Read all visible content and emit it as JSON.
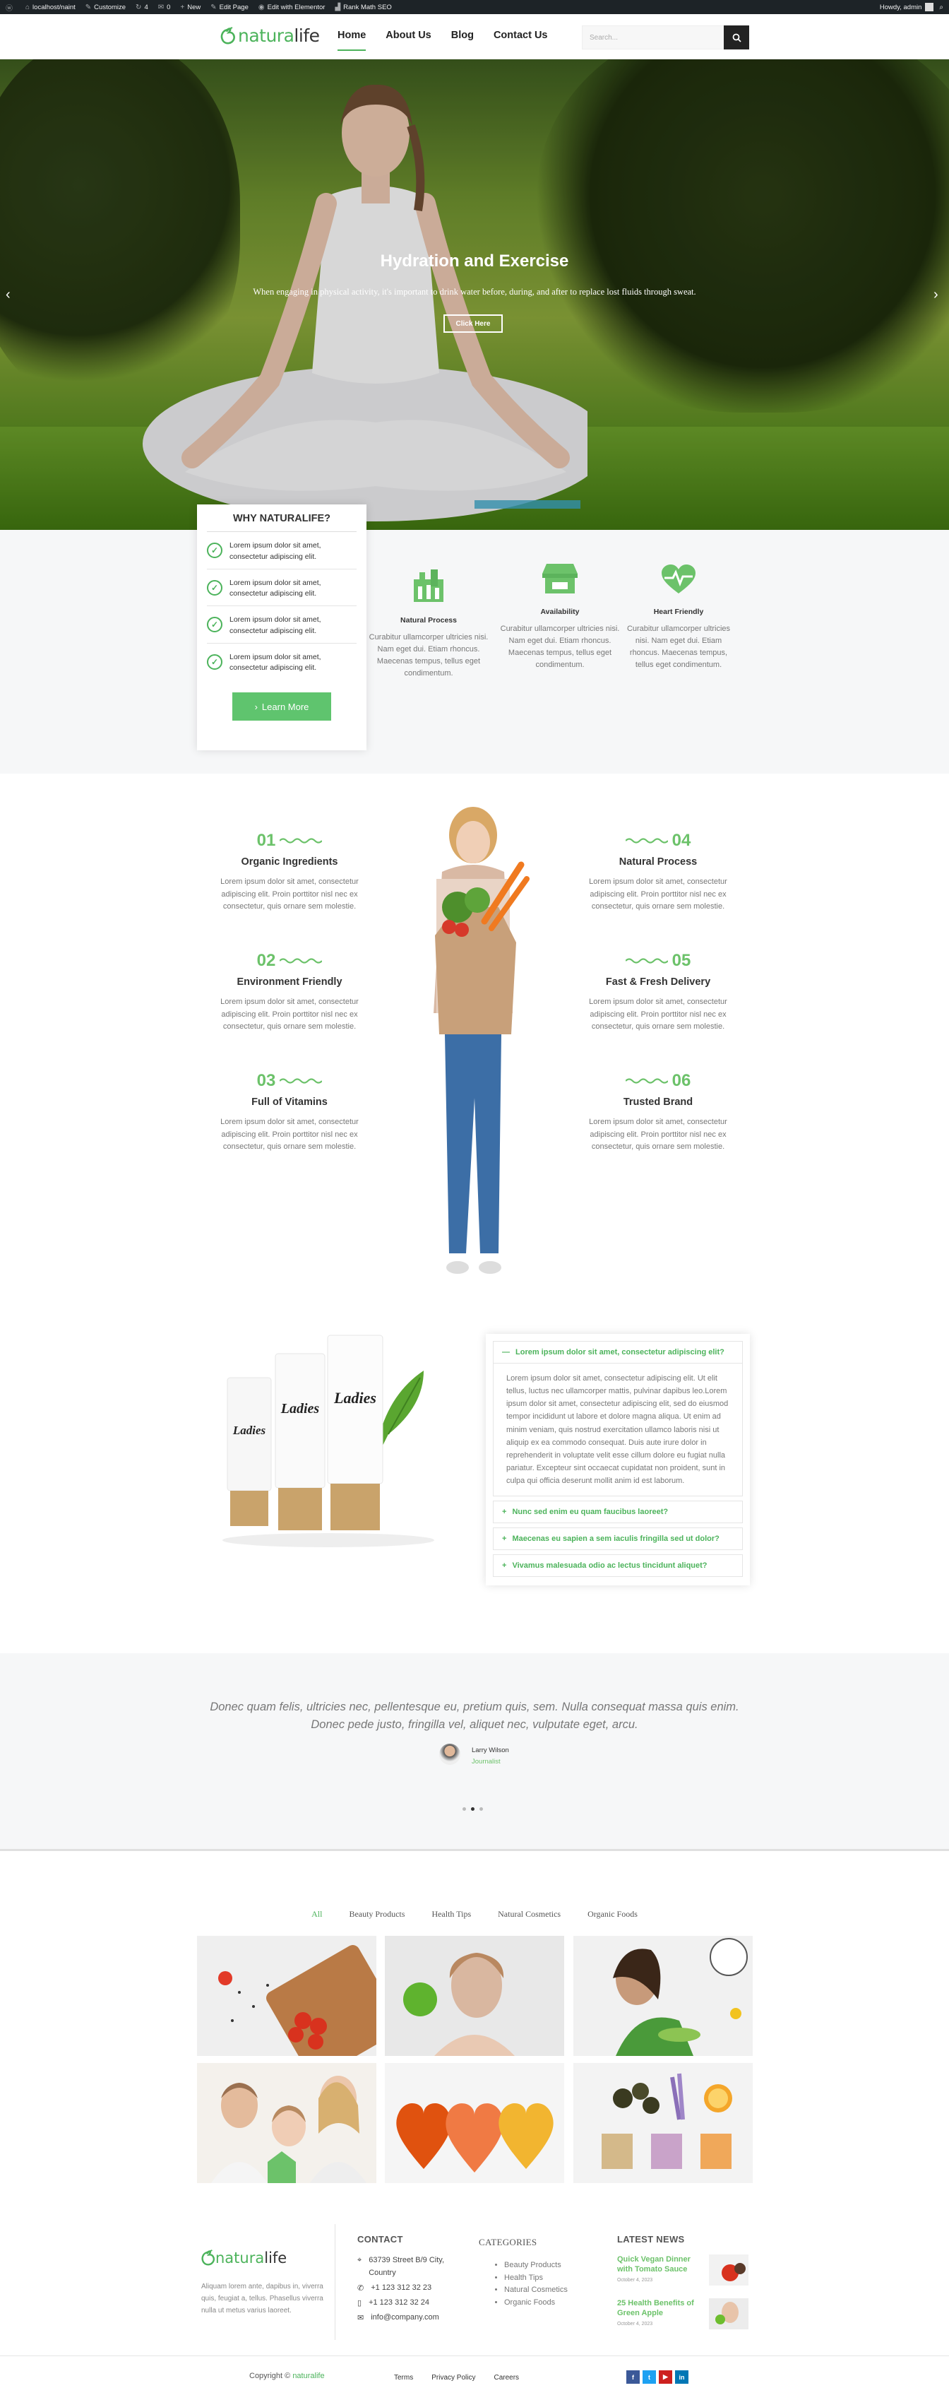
{
  "adminbar": {
    "site": "localhost/naint",
    "customize": "Customize",
    "updates": "4",
    "comments": "0",
    "new": "New",
    "edit_page": "Edit Page",
    "elementor": "Edit with Elementor",
    "rankmath": "Rank Math SEO",
    "howdy": "Howdy, admin"
  },
  "header": {
    "logo_a": "natura",
    "logo_b": "life",
    "nav": [
      "Home",
      "About Us",
      "Blog",
      "Contact Us"
    ],
    "search_placeholder": "Search..."
  },
  "hero": {
    "title": "Hydration and Exercise",
    "subtitle": "When engaging in physical activity, it's important to drink water before, during, and after to replace lost fluids through sweat.",
    "button": "Click Here"
  },
  "why": {
    "title": "WHY NATURALIFE?",
    "items": [
      "Lorem ipsum dolor sit amet, consectetur adipiscing elit.",
      "Lorem ipsum dolor sit amet, consectetur adipiscing elit.",
      "Lorem ipsum dolor sit amet, consectetur adipiscing elit.",
      "Lorem ipsum dolor sit amet, consectetur adipiscing elit."
    ],
    "button": "Learn More"
  },
  "features": [
    {
      "title": "Natural Process",
      "icon": "natural-process-icon",
      "text": "Curabitur ullamcorper ultricies nisi. Nam eget dui. Etiam rhoncus. Maecenas tempus, tellus eget condimentum."
    },
    {
      "title": "Availability",
      "icon": "store-icon",
      "text": "Curabitur ullamcorper ultricies nisi. Nam eget dui. Etiam rhoncus. Maecenas tempus, tellus eget condimentum."
    },
    {
      "title": "Heart Friendly",
      "icon": "heart-pulse-icon",
      "text": "Curabitur ullamcorper ultricies nisi. Nam eget dui. Etiam rhoncus. Maecenas tempus, tellus eget condimentum."
    }
  ],
  "benefits": [
    {
      "num": "01",
      "title": "Organic Ingredients",
      "text": "Lorem ipsum dolor sit amet, consectetur adipiscing elit. Proin porttitor nisl nec ex consectetur, quis ornare sem molestie."
    },
    {
      "num": "02",
      "title": "Environment Friendly",
      "text": "Lorem ipsum dolor sit amet, consectetur adipiscing elit. Proin porttitor nisl nec ex consectetur, quis ornare sem molestie."
    },
    {
      "num": "03",
      "title": "Full of Vitamins",
      "text": "Lorem ipsum dolor sit amet, consectetur adipiscing elit. Proin porttitor nisl nec ex consectetur, quis ornare sem molestie."
    },
    {
      "num": "04",
      "title": "Natural Process",
      "text": "Lorem ipsum dolor sit amet, consectetur adipiscing elit. Proin porttitor nisl nec ex consectetur, quis ornare sem molestie."
    },
    {
      "num": "05",
      "title": "Fast & Fresh Delivery",
      "text": "Lorem ipsum dolor sit amet, consectetur adipiscing elit. Proin porttitor nisl nec ex consectetur, quis ornare sem molestie."
    },
    {
      "num": "06",
      "title": "Trusted Brand",
      "text": "Lorem ipsum dolor sit amet, consectetur adipiscing elit. Proin porttitor nisl nec ex consectetur, quis ornare sem molestie."
    }
  ],
  "product": {
    "label": "Ladies"
  },
  "faq": {
    "open_q": "Lorem ipsum dolor sit amet, consectetur adipiscing elit?",
    "open_a": "Lorem ipsum dolor sit amet, consectetur adipiscing elit. Ut elit tellus, luctus nec ullamcorper mattis, pulvinar dapibus leo.Lorem ipsum dolor sit amet, consectetur adipiscing elit, sed do eiusmod tempor incididunt ut labore et dolore magna aliqua. Ut enim ad minim veniam, quis nostrud exercitation ullamco laboris nisi ut aliquip ex ea commodo consequat. Duis aute irure dolor in reprehenderit in voluptate velit esse cillum dolore eu fugiat nulla pariatur. Excepteur sint occaecat cupidatat non proident, sunt in culpa qui officia deserunt mollit anim id est laborum.",
    "closed": [
      "Nunc sed enim eu quam faucibus laoreet?",
      "Maecenas eu sapien a sem iaculis fringilla sed ut dolor?",
      "Vivamus malesuada odio ac lectus tincidunt aliquet?"
    ]
  },
  "testimonial": {
    "quote_1": "Donec quam felis, ultricies nec, pellentesque eu, pretium quis, sem. Nulla consequat massa quis enim.",
    "quote_2": "Donec pede justo, fringilla vel, aliquet nec, vulputate eget, arcu.",
    "name": "Larry Wilson",
    "job": "Journalist"
  },
  "gallery": {
    "filters": [
      "All",
      "Beauty Products",
      "Health Tips",
      "Natural Cosmetics",
      "Organic Foods"
    ]
  },
  "footer": {
    "about": "Aliquam lorem ante, dapibus in, viverra quis, feugiat a, tellus. Phasellus viverra nulla ut metus varius laoreet.",
    "contact_title": "CONTACT",
    "address": "63739 Street B/9 City, Country",
    "phone1": "+1 123 312 32 23",
    "phone2": "+1 123 312 32 24",
    "email": "info@company.com",
    "categories_title": "CATEGORIES",
    "categories": [
      "Beauty Products",
      "Health Tips",
      "Natural Cosmetics",
      "Organic Foods"
    ],
    "news_title": "LATEST NEWS",
    "news": [
      {
        "title": "Quick Vegan Dinner with Tomato Sauce",
        "date": "October 4, 2023"
      },
      {
        "title": "25 Health Benefits of Green Apple",
        "date": "October 4, 2023"
      }
    ],
    "copyright": "Copyright ©",
    "copyright_brand": "naturalife",
    "links": [
      "Terms",
      "Privacy Policy",
      "Careers"
    ],
    "social": [
      "f",
      "t",
      "▶",
      "in"
    ]
  },
  "colors": {
    "accent": "#4cb35b",
    "accent_light": "#6cc26a",
    "dark": "#1d2327"
  }
}
